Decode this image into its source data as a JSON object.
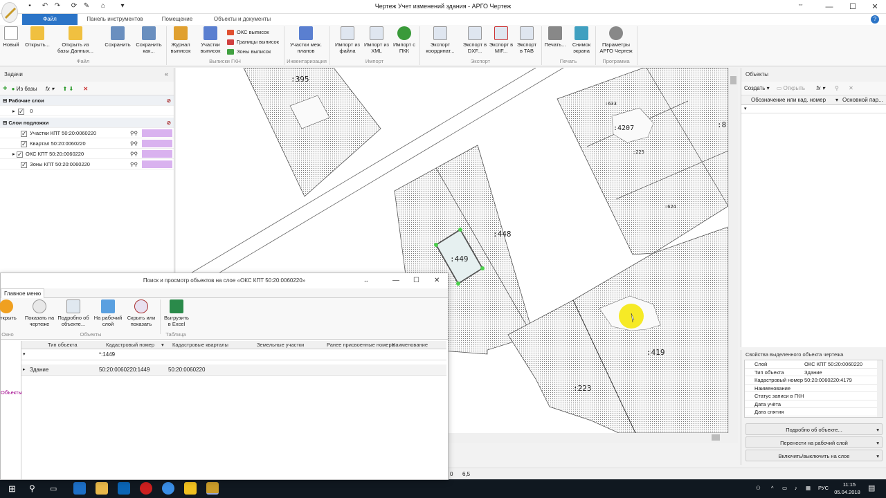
{
  "window": {
    "title": "Чертеж Учет изменений здания - АРГО Чертеж",
    "resize_glyph": "⇔"
  },
  "ribbon_tabs": [
    {
      "label": "Файл"
    },
    {
      "label": "Панель инструментов"
    },
    {
      "label": "Помещение"
    },
    {
      "label": "Объекты и документы"
    }
  ],
  "ribbon": {
    "new": "Новый",
    "open": "Открыть...",
    "open_db": "Открыть из базы Данных...",
    "save": "Сохранить",
    "save_as": "Сохранить как...",
    "journal": "Журнал выписок",
    "plots": "Участки выписок",
    "oks": "ОКС выписок",
    "borders": "Границы выписок",
    "zones": "Зоны выписок",
    "plots_plans": "Участки меж. планов",
    "import_file": "Импорт из файла",
    "import_xml": "Импорт из XML",
    "import_gkn": "Импорт с ПКК",
    "export_coords": "Экспорт координат...",
    "export_dxf": "Экспорт в DXF...",
    "export_mif": "Экспорт в MIF...",
    "export_tab": "Экспорт в TAB",
    "print": "Печать...",
    "snapshot": "Снимок экрана",
    "params": "Параметры АРГО Чертеж",
    "groups": {
      "file": "Файл",
      "extracts": "Выписки ГКН",
      "inventory": "Инвентаризация",
      "import": "Импорт",
      "export": "Экспорт",
      "print": "Печать",
      "program": "Программа"
    }
  },
  "tasks": {
    "title": "Задачи",
    "from_db": "Из базы",
    "work_layers": "Рабочие слои",
    "work_layer_0": "0",
    "base_layers": "Слои подложки",
    "layers": [
      {
        "label": "Участки КПТ 50:20:0060220"
      },
      {
        "label": "Квартал 50:20:0060220"
      },
      {
        "label": "ОКС КПТ 50:20:0060220"
      },
      {
        "label": "Зоны КПТ 50:20:0060220"
      }
    ]
  },
  "map_labels": {
    "a395": ":395",
    "a448": ":448",
    "a449": ":449",
    "a419": ":419",
    "a223": ":223",
    "a4207": ":4207",
    "a225": ":225",
    "a624": ":624",
    "a8": ":8",
    "a633": ":633"
  },
  "objects": {
    "title": "Объекты",
    "create": "Создать",
    "open": "Открыть",
    "col1": "Обозначение или кад. номер",
    "col2": "Основной пар..."
  },
  "props": {
    "title": "Свойства выделенного объекта чертежа",
    "rows": [
      {
        "k": "Слой",
        "v": "ОКС КПТ 50:20:0060220"
      },
      {
        "k": "Тип объекта",
        "v": "Здание"
      },
      {
        "k": "Кадастровый номер",
        "v": "50:20:0060220:4179"
      },
      {
        "k": "Наименование",
        "v": ""
      },
      {
        "k": "Статус записи в ГКН",
        "v": ""
      },
      {
        "k": "Дата учёта",
        "v": ""
      },
      {
        "k": "Дата снятия",
        "v": ""
      }
    ],
    "btn_details": "Подробно об объекте...",
    "btn_move": "Перенести на рабочий слой",
    "btn_toggle": "Включить/выключить на слое"
  },
  "dialog": {
    "title": "Поиск и просмотр объектов на слое «ОКС КПТ 50:20:0060220»",
    "tab": "Главное меню",
    "btn_open": "Открыть",
    "btn_show": "Показать на чертеже",
    "btn_details": "Подробно об объекте...",
    "btn_work": "На рабочий слой",
    "btn_hide": "Скрыть или показать",
    "btn_excel": "Выгрузить в Excel",
    "grp_window": "Окно",
    "grp_objects": "Объекты",
    "grp_table": "Таблица",
    "side_label": "Объекты",
    "cols": [
      "Тип объекта",
      "Кадастровый номер",
      "Кадастровые кварталы",
      "Земельные участки",
      "Ранее присвоенные номера",
      "Наименование"
    ],
    "filter": "*:1449",
    "row": {
      "type": "Здание",
      "cad": "50:20:0060220:1449",
      "quarter": "50:20:0060220"
    }
  },
  "status": {
    "coord1": "0",
    "coord2": "6,5"
  },
  "tray": {
    "lang": "РУС",
    "time": "11:15",
    "date": "05.04.2018"
  }
}
